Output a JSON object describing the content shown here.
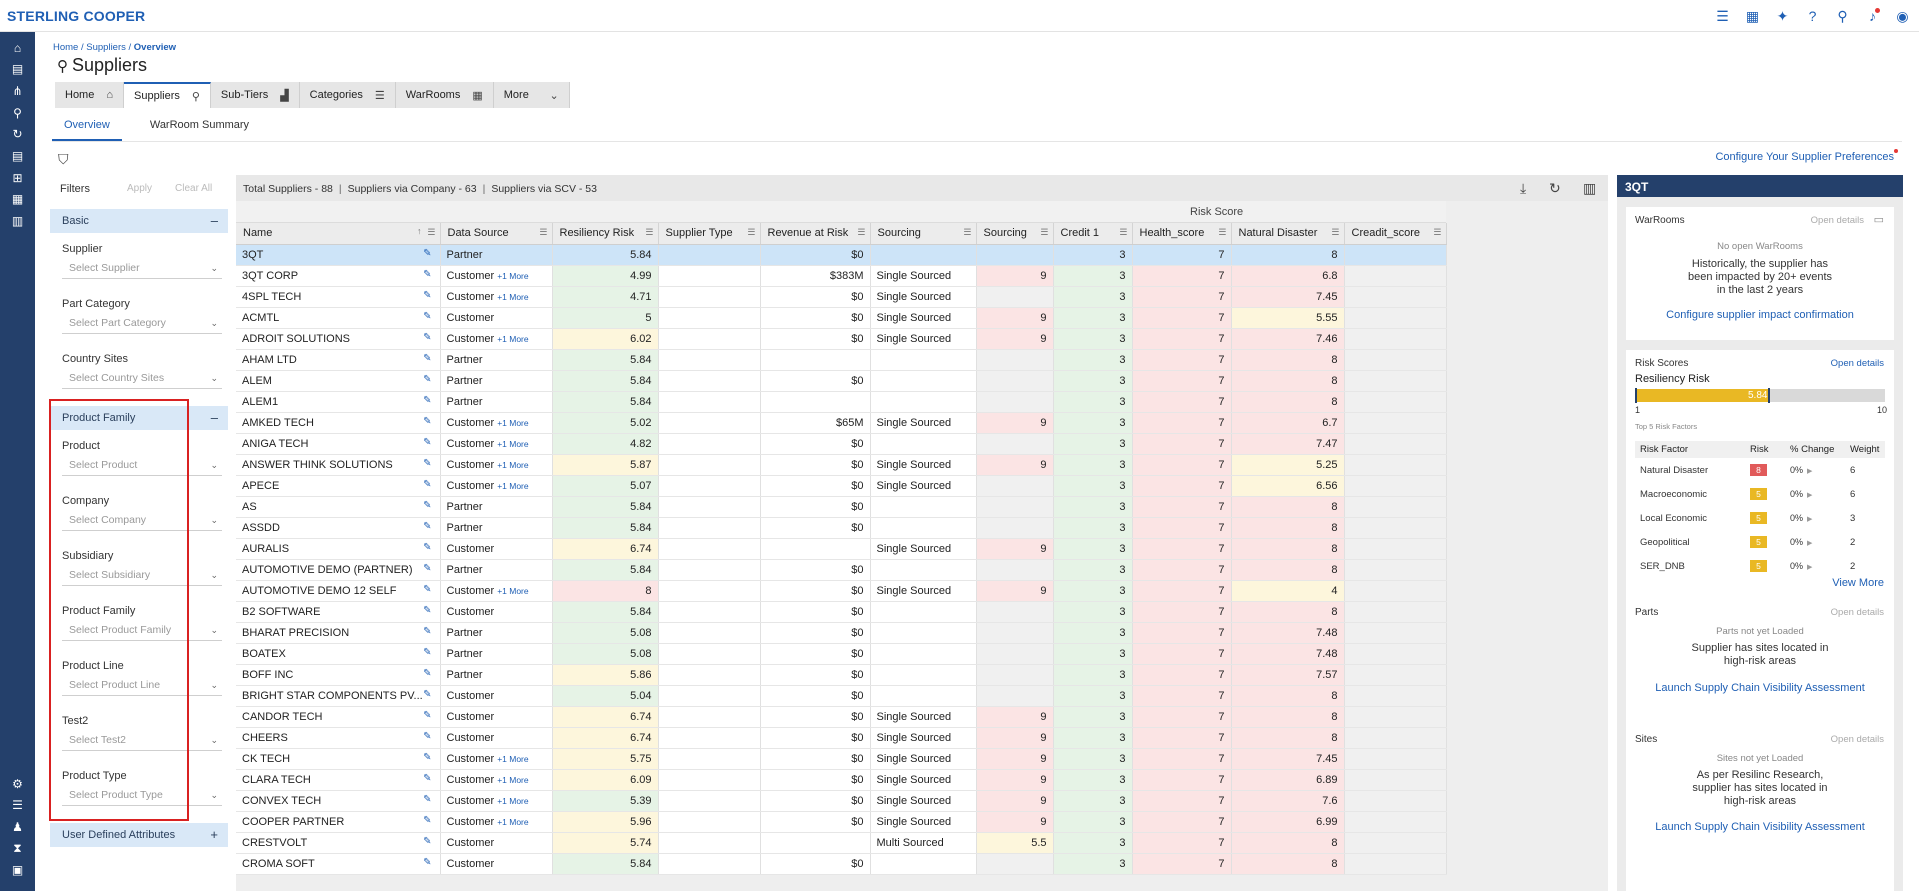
{
  "brand": "STERLING COOPER",
  "top_icons": [
    "list-icon",
    "apps-grid-icon",
    "sparkle-icon",
    "help-icon",
    "search-icon",
    "bell-icon",
    "user-circle-icon"
  ],
  "left_nav_icons": [
    "home-icon",
    "calendar-icon",
    "network-icon",
    "search-icon",
    "refresh-icon",
    "document-icon",
    "hierarchy-icon",
    "grid-icon",
    "building-icon"
  ],
  "left_nav_bottom_icons": [
    "settings-icon",
    "list-check-icon",
    "person-icon",
    "hourglass-icon",
    "clipboard-icon"
  ],
  "breadcrumb": {
    "home": "Home",
    "suppliers": "Suppliers",
    "current": "Overview"
  },
  "page_title": "Suppliers",
  "tabs": [
    {
      "label": "Home",
      "icon": "home-icon",
      "glyph": "⌂"
    },
    {
      "label": "Suppliers",
      "icon": "supplier-icon",
      "glyph": "⚲"
    },
    {
      "label": "Sub-Tiers",
      "icon": "bar-chart-icon",
      "glyph": "▟"
    },
    {
      "label": "Categories",
      "icon": "list-icon",
      "glyph": "☰"
    },
    {
      "label": "WarRooms",
      "icon": "calendar-icon",
      "glyph": "▦"
    },
    {
      "label": "More",
      "icon": "chevron-down-icon",
      "glyph": "⌄"
    }
  ],
  "subtabs": [
    "Overview",
    "WarRoom Summary"
  ],
  "configure_link": "Configure Your Supplier Preferences",
  "filters": {
    "title": "Filters",
    "apply": "Apply",
    "clear": "Clear All",
    "basic": {
      "title": "Basic",
      "items": [
        {
          "label": "Supplier",
          "placeholder": "Select Supplier"
        },
        {
          "label": "Part Category",
          "placeholder": "Select Part Category"
        },
        {
          "label": "Country Sites",
          "placeholder": "Select Country Sites"
        }
      ]
    },
    "product_family": {
      "title": "Product Family",
      "items": [
        {
          "label": "Product",
          "placeholder": "Select Product"
        },
        {
          "label": "Company",
          "placeholder": "Select Company"
        },
        {
          "label": "Subsidiary",
          "placeholder": "Select Subsidiary"
        },
        {
          "label": "Product Family",
          "placeholder": "Select Product Family"
        },
        {
          "label": "Product Line",
          "placeholder": "Select Product Line"
        },
        {
          "label": "Test2",
          "placeholder": "Select Test2"
        },
        {
          "label": "Product Type",
          "placeholder": "Select Product Type"
        }
      ]
    },
    "user_defined": "User Defined Attributes"
  },
  "grid": {
    "summary": [
      "Total Suppliers - 88",
      "Suppliers via Company - 63",
      "Suppliers via SCV - 53"
    ],
    "group_label": "Risk Score",
    "columns": [
      "Name",
      "Data Source",
      "Resiliency Risk",
      "Supplier Type",
      "Revenue at Risk",
      "Sourcing",
      "Sourcing",
      "Credit 1",
      "Health_score",
      "Natural Disaster",
      "Creadit_score"
    ],
    "more_label": "+1 More",
    "rows": [
      [
        "3QT",
        "Partner",
        false,
        "5.84",
        "g",
        "",
        "$0",
        "",
        "",
        "n",
        "3",
        "7",
        "8",
        "r",
        "sel"
      ],
      [
        "3QT CORP",
        "Customer",
        true,
        "4.99",
        "g",
        "",
        "$383M",
        "Single Sourced",
        "9",
        "r",
        "3",
        "7",
        "6.8",
        "r",
        ""
      ],
      [
        "4SPL TECH",
        "Customer",
        true,
        "4.71",
        "g",
        "",
        "$0",
        "Single Sourced",
        "",
        "n",
        "3",
        "7",
        "7.45",
        "r",
        ""
      ],
      [
        "ACMTL",
        "Customer",
        false,
        "5",
        "g",
        "",
        "$0",
        "Single Sourced",
        "9",
        "r",
        "3",
        "7",
        "5.55",
        "y",
        ""
      ],
      [
        "ADROIT SOLUTIONS",
        "Customer",
        true,
        "6.02",
        "y",
        "",
        "$0",
        "Single Sourced",
        "9",
        "r",
        "3",
        "7",
        "7.46",
        "r",
        ""
      ],
      [
        "AHAM LTD",
        "Partner",
        false,
        "5.84",
        "g",
        "",
        "",
        "",
        "",
        "n",
        "3",
        "7",
        "8",
        "r",
        ""
      ],
      [
        "ALEM",
        "Partner",
        false,
        "5.84",
        "g",
        "",
        "$0",
        "",
        "",
        "n",
        "3",
        "7",
        "8",
        "r",
        ""
      ],
      [
        "ALEM1",
        "Partner",
        false,
        "5.84",
        "g",
        "",
        "",
        "",
        "",
        "n",
        "3",
        "7",
        "8",
        "r",
        ""
      ],
      [
        "AMKED TECH",
        "Customer",
        true,
        "5.02",
        "g",
        "",
        "$65M",
        "Single Sourced",
        "9",
        "r",
        "3",
        "7",
        "6.7",
        "r",
        ""
      ],
      [
        "ANIGA TECH",
        "Customer",
        true,
        "4.82",
        "g",
        "",
        "$0",
        "",
        "",
        "n",
        "3",
        "7",
        "7.47",
        "r",
        ""
      ],
      [
        "ANSWER THINK SOLUTIONS",
        "Customer",
        true,
        "5.87",
        "y",
        "",
        "$0",
        "Single Sourced",
        "9",
        "r",
        "3",
        "7",
        "5.25",
        "y",
        ""
      ],
      [
        "APECE",
        "Customer",
        true,
        "5.07",
        "g",
        "",
        "$0",
        "Single Sourced",
        "",
        "n",
        "3",
        "7",
        "6.56",
        "y",
        ""
      ],
      [
        "AS",
        "Partner",
        false,
        "5.84",
        "g",
        "",
        "$0",
        "",
        "",
        "n",
        "3",
        "7",
        "8",
        "r",
        ""
      ],
      [
        "ASSDD",
        "Partner",
        false,
        "5.84",
        "g",
        "",
        "$0",
        "",
        "",
        "n",
        "3",
        "7",
        "8",
        "r",
        ""
      ],
      [
        "AURALIS",
        "Customer",
        false,
        "6.74",
        "y",
        "",
        "",
        "Single Sourced",
        "9",
        "r",
        "3",
        "7",
        "8",
        "r",
        ""
      ],
      [
        "AUTOMOTIVE DEMO (PARTNER)",
        "Partner",
        false,
        "5.84",
        "g",
        "",
        "$0",
        "",
        "",
        "n",
        "3",
        "7",
        "8",
        "r",
        ""
      ],
      [
        "AUTOMOTIVE DEMO 12 SELF",
        "Customer",
        true,
        "8",
        "r",
        "",
        "$0",
        "Single Sourced",
        "9",
        "r",
        "3",
        "7",
        "4",
        "y",
        ""
      ],
      [
        "B2 SOFTWARE",
        "Customer",
        false,
        "5.84",
        "g",
        "",
        "$0",
        "",
        "",
        "n",
        "3",
        "7",
        "8",
        "r",
        ""
      ],
      [
        "BHARAT PRECISION",
        "Partner",
        false,
        "5.08",
        "g",
        "",
        "$0",
        "",
        "",
        "n",
        "3",
        "7",
        "7.48",
        "r",
        ""
      ],
      [
        "BOATEX",
        "Partner",
        false,
        "5.08",
        "g",
        "",
        "$0",
        "",
        "",
        "n",
        "3",
        "7",
        "7.48",
        "r",
        ""
      ],
      [
        "BOFF INC",
        "Partner",
        false,
        "5.86",
        "y",
        "",
        "$0",
        "",
        "",
        "n",
        "3",
        "7",
        "7.57",
        "r",
        ""
      ],
      [
        "BRIGHT STAR COMPONENTS PV...",
        "Customer",
        false,
        "5.04",
        "g",
        "",
        "$0",
        "",
        "",
        "n",
        "3",
        "7",
        "8",
        "r",
        ""
      ],
      [
        "CANDOR TECH",
        "Customer",
        false,
        "6.74",
        "y",
        "",
        "$0",
        "Single Sourced",
        "9",
        "r",
        "3",
        "7",
        "8",
        "r",
        ""
      ],
      [
        "CHEERS",
        "Customer",
        false,
        "6.74",
        "y",
        "",
        "$0",
        "Single Sourced",
        "9",
        "r",
        "3",
        "7",
        "8",
        "r",
        ""
      ],
      [
        "CK TECH",
        "Customer",
        true,
        "5.75",
        "y",
        "",
        "$0",
        "Single Sourced",
        "9",
        "r",
        "3",
        "7",
        "7.45",
        "r",
        ""
      ],
      [
        "CLARA TECH",
        "Customer",
        true,
        "6.09",
        "y",
        "",
        "$0",
        "Single Sourced",
        "9",
        "r",
        "3",
        "7",
        "6.89",
        "r",
        ""
      ],
      [
        "CONVEX TECH",
        "Customer",
        true,
        "5.39",
        "g",
        "",
        "$0",
        "Single Sourced",
        "9",
        "r",
        "3",
        "7",
        "7.6",
        "r",
        ""
      ],
      [
        "COOPER PARTNER",
        "Customer",
        true,
        "5.96",
        "y",
        "",
        "$0",
        "Single Sourced",
        "9",
        "r",
        "3",
        "7",
        "6.99",
        "r",
        ""
      ],
      [
        "CRESTVOLT",
        "Customer",
        false,
        "5.74",
        "y",
        "",
        "",
        "Multi Sourced",
        "5.5",
        "y",
        "3",
        "7",
        "8",
        "r",
        ""
      ],
      [
        "CROMA SOFT",
        "Customer",
        false,
        "5.84",
        "g",
        "",
        "$0",
        "",
        "",
        "n",
        "3",
        "7",
        "8",
        "r",
        ""
      ]
    ]
  },
  "side_panel": {
    "title": "3QT",
    "warrooms": {
      "title": "WarRooms",
      "open": "Open details",
      "empty": "No open WarRooms",
      "text": [
        "Historically, the supplier has",
        "been impacted by 20+ events",
        "in the last 2 years"
      ],
      "link": "Configure supplier impact confirmation"
    },
    "risk": {
      "title": "Risk Scores",
      "open": "Open details",
      "label": "Resiliency Risk",
      "value": 5.84,
      "min": "1",
      "max": "10",
      "top5": "Top 5 Risk Factors",
      "headers": [
        "Risk Factor",
        "Risk",
        "% Change",
        "Weight"
      ],
      "factors": [
        {
          "name": "Natural Disaster",
          "risk": "8",
          "level": "red",
          "change": "0%",
          "weight": "6"
        },
        {
          "name": "Macroeconomic",
          "risk": "5",
          "level": "yel",
          "change": "0%",
          "weight": "6"
        },
        {
          "name": "Local Economic",
          "risk": "5",
          "level": "yel",
          "change": "0%",
          "weight": "3"
        },
        {
          "name": "Geopolitical",
          "risk": "5",
          "level": "yel",
          "change": "0%",
          "weight": "2"
        },
        {
          "name": "SER_DNB",
          "risk": "5",
          "level": "yel",
          "change": "0%",
          "weight": "2"
        }
      ],
      "view_more": "View More"
    },
    "parts": {
      "title": "Parts",
      "open": "Open details",
      "muted": "Parts not yet Loaded",
      "text": [
        "Supplier has sites located in",
        "high-risk areas"
      ],
      "link": "Launch Supply Chain Visibility Assessment"
    },
    "sites": {
      "title": "Sites",
      "open": "Open details",
      "muted": "Sites not yet Loaded",
      "text": [
        "As per Resilinc Research,",
        "supplier has sites located in",
        "high-risk areas"
      ],
      "link": "Launch Supply Chain Visibility Assessment"
    }
  }
}
